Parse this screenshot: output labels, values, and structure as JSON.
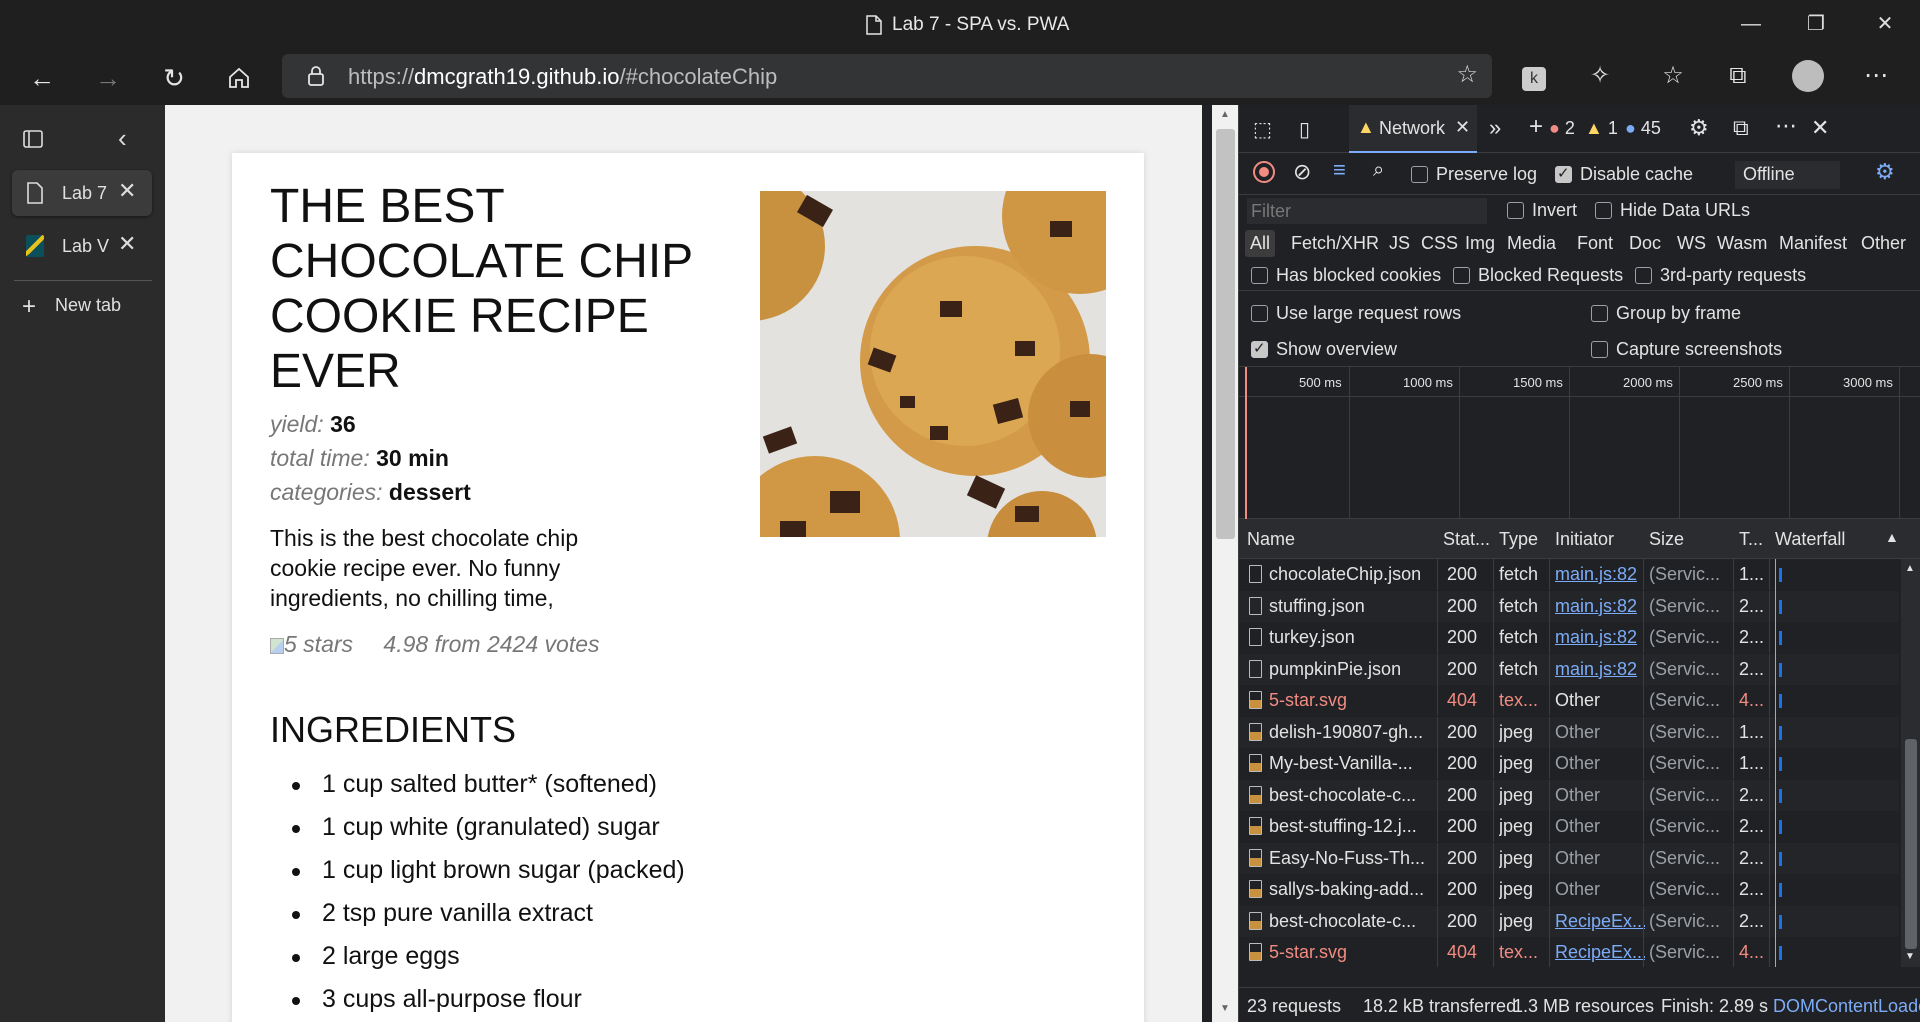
{
  "window": {
    "title": "Lab 7 - SPA vs. PWA",
    "minimize": "—",
    "maximize": "❐",
    "close": "✕"
  },
  "nav": {
    "url_prefix": "https://",
    "url_host": "dmcgrath19.github.io",
    "url_path": "/#chocolateChip"
  },
  "tabs": {
    "items": [
      {
        "label": "Lab 7",
        "close": "✕"
      },
      {
        "label": "Lab V",
        "close": "✕"
      }
    ],
    "new_tab": "New tab"
  },
  "recipe": {
    "title": "THE BEST CHOCOLATE CHIP COOKIE RECIPE EVER",
    "yield_label": "yield:",
    "yield_value": "36",
    "time_label": "total time:",
    "time_value": "30 min",
    "cat_label": "categories:",
    "cat_value": "dessert",
    "description": "This is the best chocolate chip cookie recipe ever. No funny ingredients, no chilling time,",
    "rating_alt": "5 stars",
    "rating_text": "4.98 from 2424 votes",
    "ingredients_title": "INGREDIENTS",
    "ingredients": [
      "1 cup salted butter* (softened)",
      "1 cup white (granulated) sugar",
      "1 cup light brown sugar (packed)",
      "2 tsp pure vanilla extract",
      "2 large eggs",
      "3 cups all-purpose flour"
    ]
  },
  "devtools": {
    "active_tab": "Network",
    "error_count": "2",
    "warning_count": "1",
    "info_count": "45",
    "toolbar": {
      "preserve_log": "Preserve log",
      "disable_cache": "Disable cache",
      "throttle": "Offline"
    },
    "filter_placeholder": "Filter",
    "invert": "Invert",
    "hide_data_urls": "Hide Data URLs",
    "types": [
      "All",
      "Fetch/XHR",
      "JS",
      "CSS",
      "Img",
      "Media",
      "Font",
      "Doc",
      "WS",
      "Wasm",
      "Manifest",
      "Other"
    ],
    "has_blocked_cookies": "Has blocked cookies",
    "blocked_requests": "Blocked Requests",
    "third_party": "3rd-party requests",
    "large_rows": "Use large request rows",
    "group_by_frame": "Group by frame",
    "show_overview": "Show overview",
    "capture_screenshots": "Capture screenshots",
    "timeline_ticks": [
      "500 ms",
      "1000 ms",
      "1500 ms",
      "2000 ms",
      "2500 ms",
      "3000 ms"
    ],
    "columns": [
      "Name",
      "Stat...",
      "Type",
      "Initiator",
      "Size",
      "T...",
      "Waterfall"
    ],
    "rows": [
      {
        "name": "chocolateChip.json",
        "status": "200",
        "type": "fetch",
        "initiator": "main.js:82",
        "size": "(Servic...",
        "time": "1...",
        "icon": "doc",
        "err": false,
        "link": true
      },
      {
        "name": "stuffing.json",
        "status": "200",
        "type": "fetch",
        "initiator": "main.js:82",
        "size": "(Servic...",
        "time": "2...",
        "icon": "doc",
        "err": false,
        "link": true
      },
      {
        "name": "turkey.json",
        "status": "200",
        "type": "fetch",
        "initiator": "main.js:82",
        "size": "(Servic...",
        "time": "2...",
        "icon": "doc",
        "err": false,
        "link": true
      },
      {
        "name": "pumpkinPie.json",
        "status": "200",
        "type": "fetch",
        "initiator": "main.js:82",
        "size": "(Servic...",
        "time": "2...",
        "icon": "doc",
        "err": false,
        "link": true
      },
      {
        "name": "5-star.svg",
        "status": "404",
        "type": "tex...",
        "initiator": "Other",
        "size": "(Servic...",
        "time": "4...",
        "icon": "img",
        "err": true,
        "link": false
      },
      {
        "name": "delish-190807-gh...",
        "status": "200",
        "type": "jpeg",
        "initiator": "Other",
        "size": "(Servic...",
        "time": "1...",
        "icon": "img",
        "err": false,
        "link": false
      },
      {
        "name": "My-best-Vanilla-...",
        "status": "200",
        "type": "jpeg",
        "initiator": "Other",
        "size": "(Servic...",
        "time": "1...",
        "icon": "img",
        "err": false,
        "link": false
      },
      {
        "name": "best-chocolate-c...",
        "status": "200",
        "type": "jpeg",
        "initiator": "Other",
        "size": "(Servic...",
        "time": "2...",
        "icon": "img",
        "err": false,
        "link": false
      },
      {
        "name": "best-stuffing-12.j...",
        "status": "200",
        "type": "jpeg",
        "initiator": "Other",
        "size": "(Servic...",
        "time": "2...",
        "icon": "img",
        "err": false,
        "link": false
      },
      {
        "name": "Easy-No-Fuss-Th...",
        "status": "200",
        "type": "jpeg",
        "initiator": "Other",
        "size": "(Servic...",
        "time": "2...",
        "icon": "img",
        "err": false,
        "link": false
      },
      {
        "name": "sallys-baking-add...",
        "status": "200",
        "type": "jpeg",
        "initiator": "Other",
        "size": "(Servic...",
        "time": "2...",
        "icon": "img",
        "err": false,
        "link": false
      },
      {
        "name": "best-chocolate-c...",
        "status": "200",
        "type": "jpeg",
        "initiator": "RecipeEx...",
        "size": "(Servic...",
        "time": "2...",
        "icon": "img",
        "err": false,
        "link": true
      },
      {
        "name": "5-star.svg",
        "status": "404",
        "type": "tex...",
        "initiator": "RecipeEx...",
        "size": "(Servic...",
        "time": "4...",
        "icon": "img",
        "err": true,
        "link": true
      }
    ],
    "status_bar": {
      "requests": "23 requests",
      "transferred": "18.2 kB transferred",
      "resources": "1.3 MB resources",
      "finish": "Finish: 2.89 s",
      "dcl": "DOMContentLoaded"
    }
  },
  "colors": {
    "bg_dark": "#202124",
    "link": "#7cacf8",
    "error": "#f28b82",
    "accent": "#1a73e8"
  }
}
